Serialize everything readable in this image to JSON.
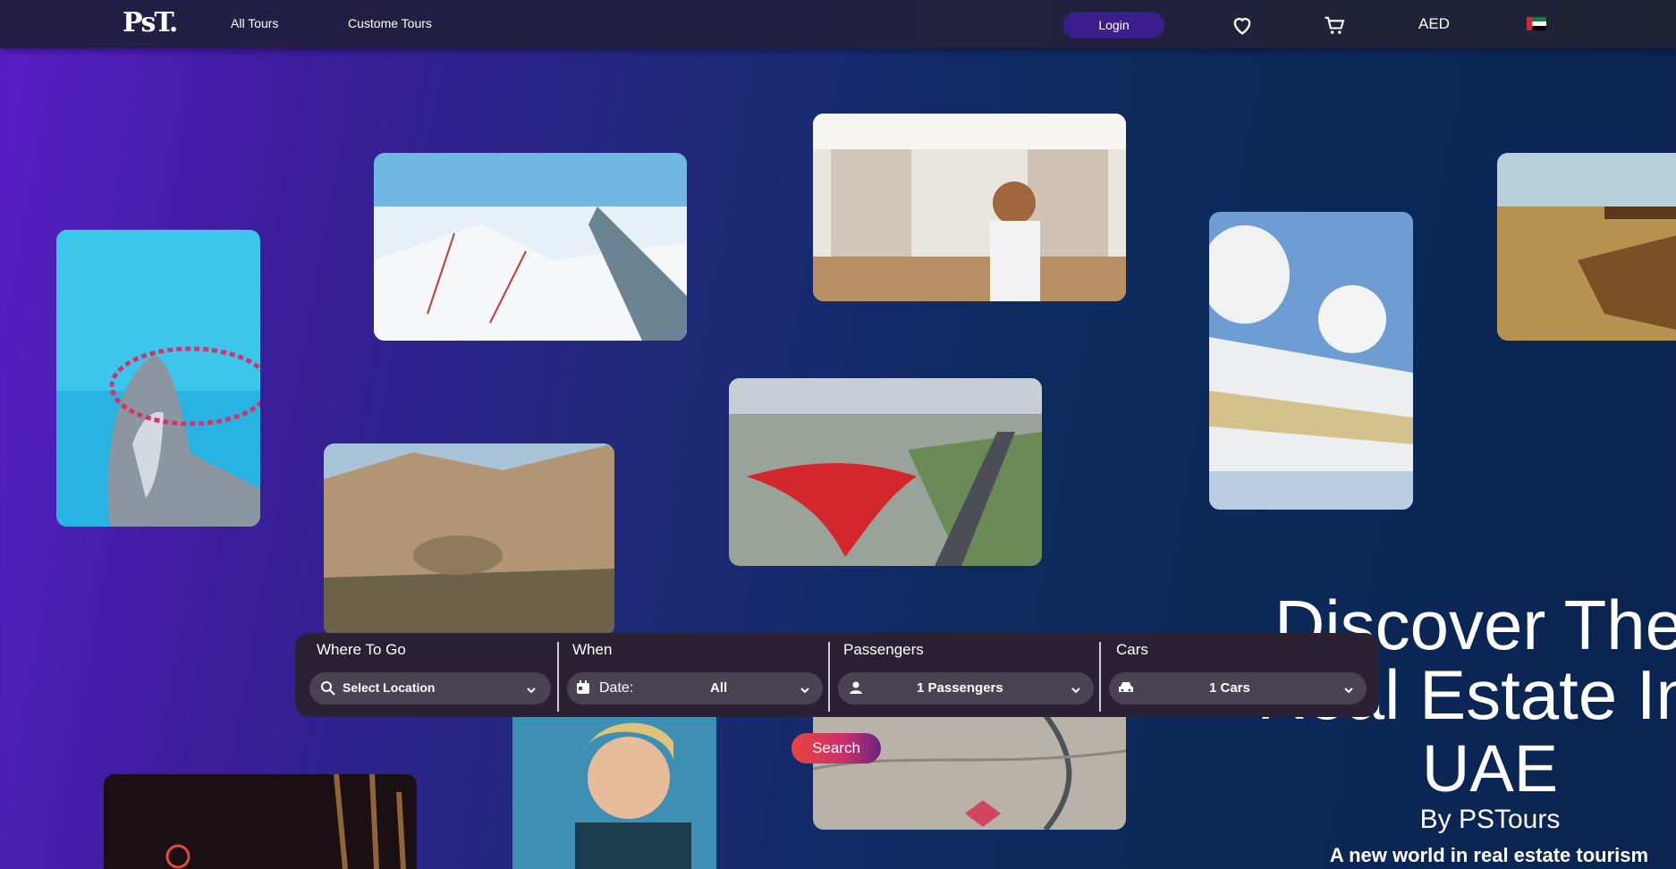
{
  "header": {
    "logo": "PsT.",
    "nav": [
      "All Tours",
      "Custome Tours"
    ],
    "login_label": "Login",
    "currency": "AED"
  },
  "search": {
    "where": {
      "label": "Where To Go",
      "value": "Select Location"
    },
    "when": {
      "label": "When",
      "prefix": "Date:",
      "value": "All"
    },
    "passengers": {
      "label": "Passengers",
      "value": "1 Passengers"
    },
    "cars": {
      "label": "Cars",
      "value": "1 Cars"
    },
    "button_label": "Search"
  },
  "hero": {
    "line1": "Discover The",
    "line2": "Real Estate In",
    "line3": "UAE",
    "byline": "By PSTours",
    "tagline": "A new world in real estate tourism"
  },
  "colors": {
    "accent_start": "#e9453c",
    "accent_end": "#6b2480",
    "login_bg": "#3b1e8c",
    "panel_bg": "#2a2232"
  }
}
